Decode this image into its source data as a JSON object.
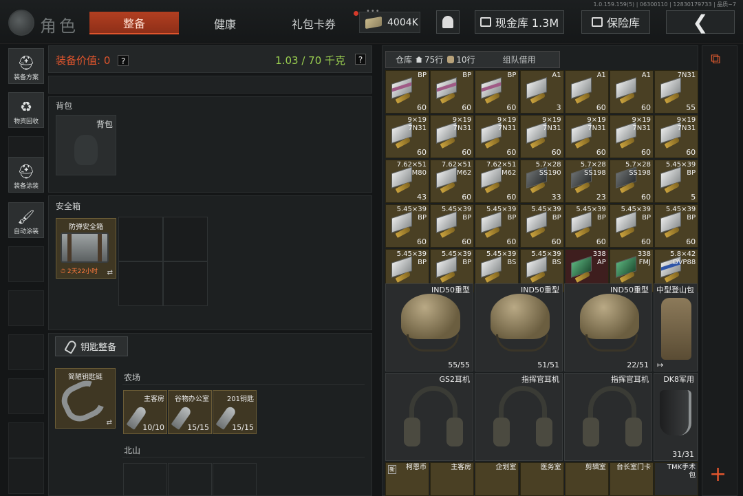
{
  "header": {
    "version": "1.0.159.159(5) | 06300110 | 12830179733 | 品质~7",
    "title": "角色",
    "tabs": [
      {
        "label": "整备",
        "active": true
      },
      {
        "label": "健康",
        "active": false
      },
      {
        "label": "礼包卡券",
        "active": false
      }
    ],
    "currency": "4004K",
    "cash_vault_label": "现金库 1.3M",
    "safe_vault_label": "保险库",
    "back_icon": "chevron-left-icon",
    "accent_color": "#e0552d"
  },
  "sidebar": {
    "items": [
      {
        "label": "装备方案",
        "icon": "helmet-icon"
      },
      {
        "label": "物资回收",
        "icon": "recycle-icon"
      },
      {
        "label": "装备涂装",
        "icon": "paint-icon"
      },
      {
        "label": "自动涂装",
        "icon": "brush-icon"
      }
    ]
  },
  "equipment": {
    "value_label": "装备价值: 0",
    "weight_label": "1.03 / 70 千克",
    "help": "?",
    "backpack_section": "背包",
    "backpack_slot": "背包",
    "safe_section": "安全箱",
    "safe_item_name": "防弹安全箱",
    "safe_timer": "2天22小时",
    "keys_button": "钥匙整备",
    "keychain_name": "简陋钥匙链",
    "location_farm": "农场",
    "location_north": "北山",
    "keys": [
      {
        "name": "主客房",
        "count": "10/10"
      },
      {
        "name": "谷物办公室",
        "count": "15/15"
      },
      {
        "name": "201钥匙",
        "count": "15/15"
      }
    ]
  },
  "inventory": {
    "tabs": {
      "warehouse": "仓库",
      "rows": "75行",
      "bag_rows": "10行",
      "team_borrow": "组队借用"
    },
    "ammo_rows": [
      [
        {
          "cal": "BP",
          "count": "60",
          "style": "pink"
        },
        {
          "cal": "BP",
          "count": "60",
          "style": "pink"
        },
        {
          "cal": "BP",
          "count": "60",
          "style": "pink"
        },
        {
          "cal": "A1",
          "count": "3",
          "style": "plain"
        },
        {
          "cal": "A1",
          "count": "60",
          "style": "plain"
        },
        {
          "cal": "A1",
          "count": "60",
          "style": "plain"
        },
        {
          "cal": "7N31",
          "count": "55",
          "style": "plain"
        }
      ],
      [
        {
          "cal": "9×19\n7N31",
          "count": "60",
          "style": "plain"
        },
        {
          "cal": "9×19\n7N31",
          "count": "60",
          "style": "plain"
        },
        {
          "cal": "9×19\n7N31",
          "count": "60",
          "style": "plain"
        },
        {
          "cal": "9×19\n7N31",
          "count": "60",
          "style": "plain"
        },
        {
          "cal": "9×19\n7N31",
          "count": "60",
          "style": "plain"
        },
        {
          "cal": "9×19\n7N31",
          "count": "60",
          "style": "plain"
        },
        {
          "cal": "9×19\n7N31",
          "count": "60",
          "style": "plain"
        }
      ],
      [
        {
          "cal": "7.62×51\nM80",
          "count": "43",
          "style": "plain"
        },
        {
          "cal": "7.62×51\nM62",
          "count": "60",
          "style": "plain"
        },
        {
          "cal": "7.62×51\nM62",
          "count": "60",
          "style": "plain"
        },
        {
          "cal": "5.7×28\nSS190",
          "count": "33",
          "style": "dark"
        },
        {
          "cal": "5.7×28\nSS198",
          "count": "23",
          "style": "dark"
        },
        {
          "cal": "5.7×28\nSS198",
          "count": "60",
          "style": "dark"
        },
        {
          "cal": "5.45×39\nBP",
          "count": "5",
          "style": "plain"
        }
      ],
      [
        {
          "cal": "5.45×39\nBP",
          "count": "60",
          "style": "plain"
        },
        {
          "cal": "5.45×39\nBP",
          "count": "60",
          "style": "plain"
        },
        {
          "cal": "5.45×39\nBP",
          "count": "60",
          "style": "plain"
        },
        {
          "cal": "5.45×39\nBP",
          "count": "60",
          "style": "plain"
        },
        {
          "cal": "5.45×39\nBP",
          "count": "60",
          "style": "plain"
        },
        {
          "cal": "5.45×39\nBP",
          "count": "60",
          "style": "plain"
        },
        {
          "cal": "5.45×39\nBP",
          "count": "60",
          "style": "plain"
        }
      ],
      [
        {
          "cal": "5.45×39\nBP",
          "count": "60",
          "style": "plain"
        },
        {
          "cal": "5.45×39\nBP",
          "count": "60",
          "style": "plain"
        },
        {
          "cal": "5.45×39\nBS",
          "count": "52",
          "style": "plain"
        },
        {
          "cal": "5.45×39\nBS",
          "count": "60",
          "style": "plain"
        },
        {
          "cal": "338\nAP",
          "count": "13",
          "style": "green-red"
        },
        {
          "cal": "338\nFMJ",
          "count": "8",
          "style": "green"
        },
        {
          "cal": "5.8×42\nDVP88",
          "count": "60",
          "style": "blue"
        }
      ]
    ],
    "helmets": [
      {
        "name": "IND50重型",
        "durability": "55/55"
      },
      {
        "name": "IND50重型",
        "durability": "51/51"
      },
      {
        "name": "IND50重型",
        "durability": "22/51"
      }
    ],
    "backpack": {
      "name": "中型登山包"
    },
    "headsets": [
      {
        "name": "GS2耳机"
      },
      {
        "name": "指挥官耳机"
      },
      {
        "name": "指挥官耳机"
      }
    ],
    "faceshield": {
      "name": "DK8军用",
      "durability": "31/31"
    },
    "bottom_row": [
      {
        "name": "柯恩币",
        "new": true
      },
      {
        "name": "主客房"
      },
      {
        "name": "企划室"
      },
      {
        "name": "医务室"
      },
      {
        "name": "剪辑室"
      },
      {
        "name": "台长室门卡"
      },
      {
        "name": "TMK手术\n包"
      }
    ],
    "new_tag": "新"
  }
}
